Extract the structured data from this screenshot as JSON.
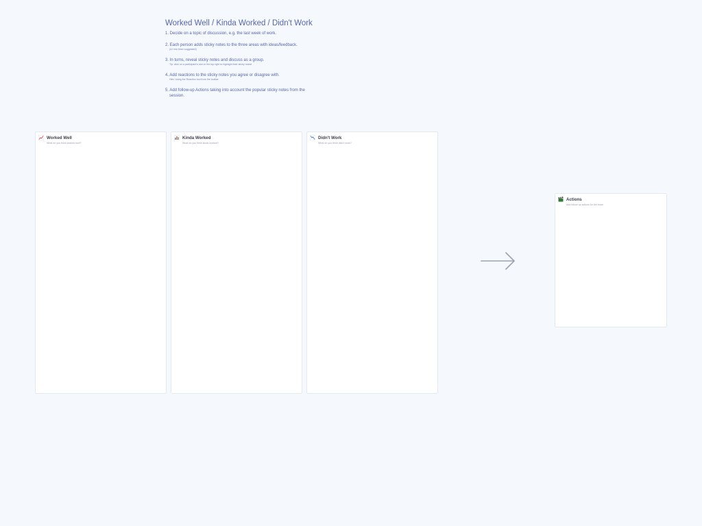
{
  "instructions": {
    "title": "Worked Well / Kinda Worked / Didn't Work",
    "steps": [
      {
        "text": "1. Decide on a topic of discussion, e.g. the last week of work.",
        "tip": ""
      },
      {
        "text": "2. Each person adds sticky notes to the three areas with ideas/feedback.",
        "tip": "(41 min timer suggested)"
      },
      {
        "text": "3. In turns, reveal sticky notes and discuss as a group.",
        "tip": "Tip: click on a participant's icon in the top right to highlight their sticky notes!"
      },
      {
        "text": "4. Add reactions to the sticky notes you agree or disagree with.",
        "tip": "Hint: Using the Reaction tool from the toolbar"
      },
      {
        "text": "5. Add follow-up Actions taking into account the popular sticky notes from the session.",
        "tip": ""
      }
    ]
  },
  "frames": {
    "worked_well": {
      "icon": "chart-increasing-icon",
      "title": "Worked Well",
      "subtitle": "What do you think worked well?"
    },
    "kinda_worked": {
      "icon": "bar-chart-icon",
      "title": "Kinda Worked",
      "subtitle": "What do you think kinda worked?"
    },
    "didnt_work": {
      "icon": "chart-decreasing-icon",
      "title": "Didn't Work",
      "subtitle": "What do you think didn't work?"
    },
    "actions": {
      "icon": "clapper-board-icon",
      "title": "Actions",
      "subtitle": "Add follow up actions for the team"
    }
  },
  "arrow": {
    "icon": "arrow-right-icon",
    "color": "#9aa3ae"
  }
}
